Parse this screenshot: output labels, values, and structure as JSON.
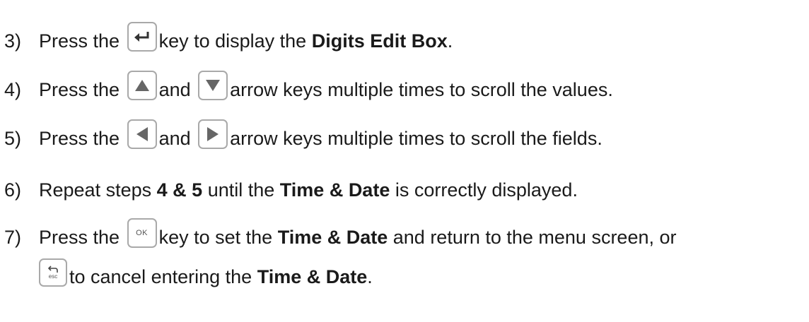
{
  "steps": [
    {
      "number": "3)",
      "pre": "Press the",
      "key": "enter-key",
      "post": "key to display the",
      "bold": "Digits Edit Box",
      "end": "."
    },
    {
      "number": "4)",
      "pre": "Press the",
      "key1": "up-arrow-key",
      "mid": "and",
      "key2": "down-arrow-key",
      "post": "arrow keys multiple times to scroll the values."
    },
    {
      "number": "5)",
      "pre": "Press the",
      "key1": "left-arrow-key",
      "mid": "and",
      "key2": "right-arrow-key",
      "post": "arrow keys multiple times to scroll the fields."
    },
    {
      "number": "6)",
      "pre": "Repeat steps",
      "bold1": "4 & 5",
      "mid": "until the",
      "bold2": "Time & Date",
      "end": "is correctly displayed."
    },
    {
      "number": "7)",
      "pre": "Press the",
      "key_label": "OK",
      "post": "key to set the",
      "bold": "Time & Date",
      "end": "and return to the menu screen, or",
      "cont_key_label": "esc",
      "cont_pre": "to cancel entering the",
      "cont_bold": "Time & Date",
      "cont_end": "."
    }
  ],
  "colors": {
    "text": "#1a1a1a",
    "key_border": "#a9a9a9",
    "key_glyph": "#333333"
  }
}
